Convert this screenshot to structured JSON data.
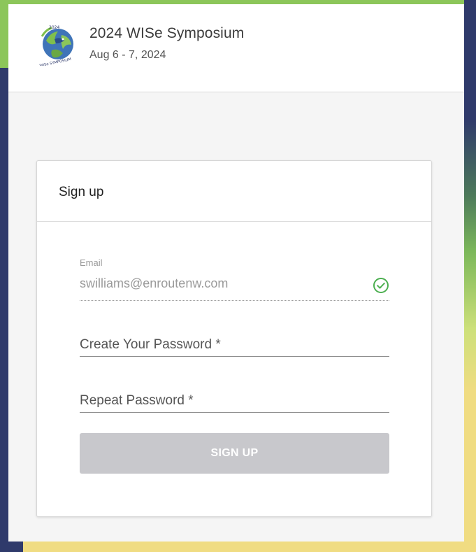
{
  "header": {
    "logo_icon": "wise-symposium-logo",
    "logo_text_top": "2024",
    "logo_text_bottom": "WISe SYMPOSIUM",
    "title": "2024 WISe Symposium",
    "dates": "Aug 6 - 7, 2024"
  },
  "card": {
    "title": "Sign up"
  },
  "form": {
    "email": {
      "label": "Email",
      "value": "swilliams@enroutenw.com",
      "status_icon": "check-circle-icon",
      "status_color": "#4caf50"
    },
    "password": {
      "placeholder": "Create Your Password *"
    },
    "repeat_password": {
      "placeholder": "Repeat Password *"
    },
    "submit_label": "SIGN UP"
  },
  "colors": {
    "background_navy": "#2f3a6b",
    "background_green": "#8cc65a",
    "background_yellow": "#f0dc82",
    "button_disabled": "#c8c8cc"
  }
}
